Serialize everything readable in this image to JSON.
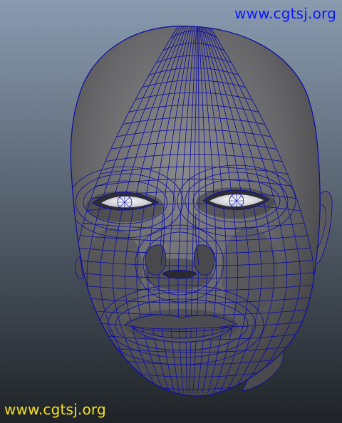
{
  "viewport": {
    "background_top": "#8a9bb0",
    "background_bottom": "#1f2327",
    "mesh_shade": "#5f5f62",
    "wire_color": "#1010a0"
  },
  "watermarks": {
    "top": {
      "text": "www.cgtsj.org",
      "color": "#0a18ff"
    },
    "bottom": {
      "text": "www.cgtsj.org",
      "color": "#f4e21e"
    }
  }
}
